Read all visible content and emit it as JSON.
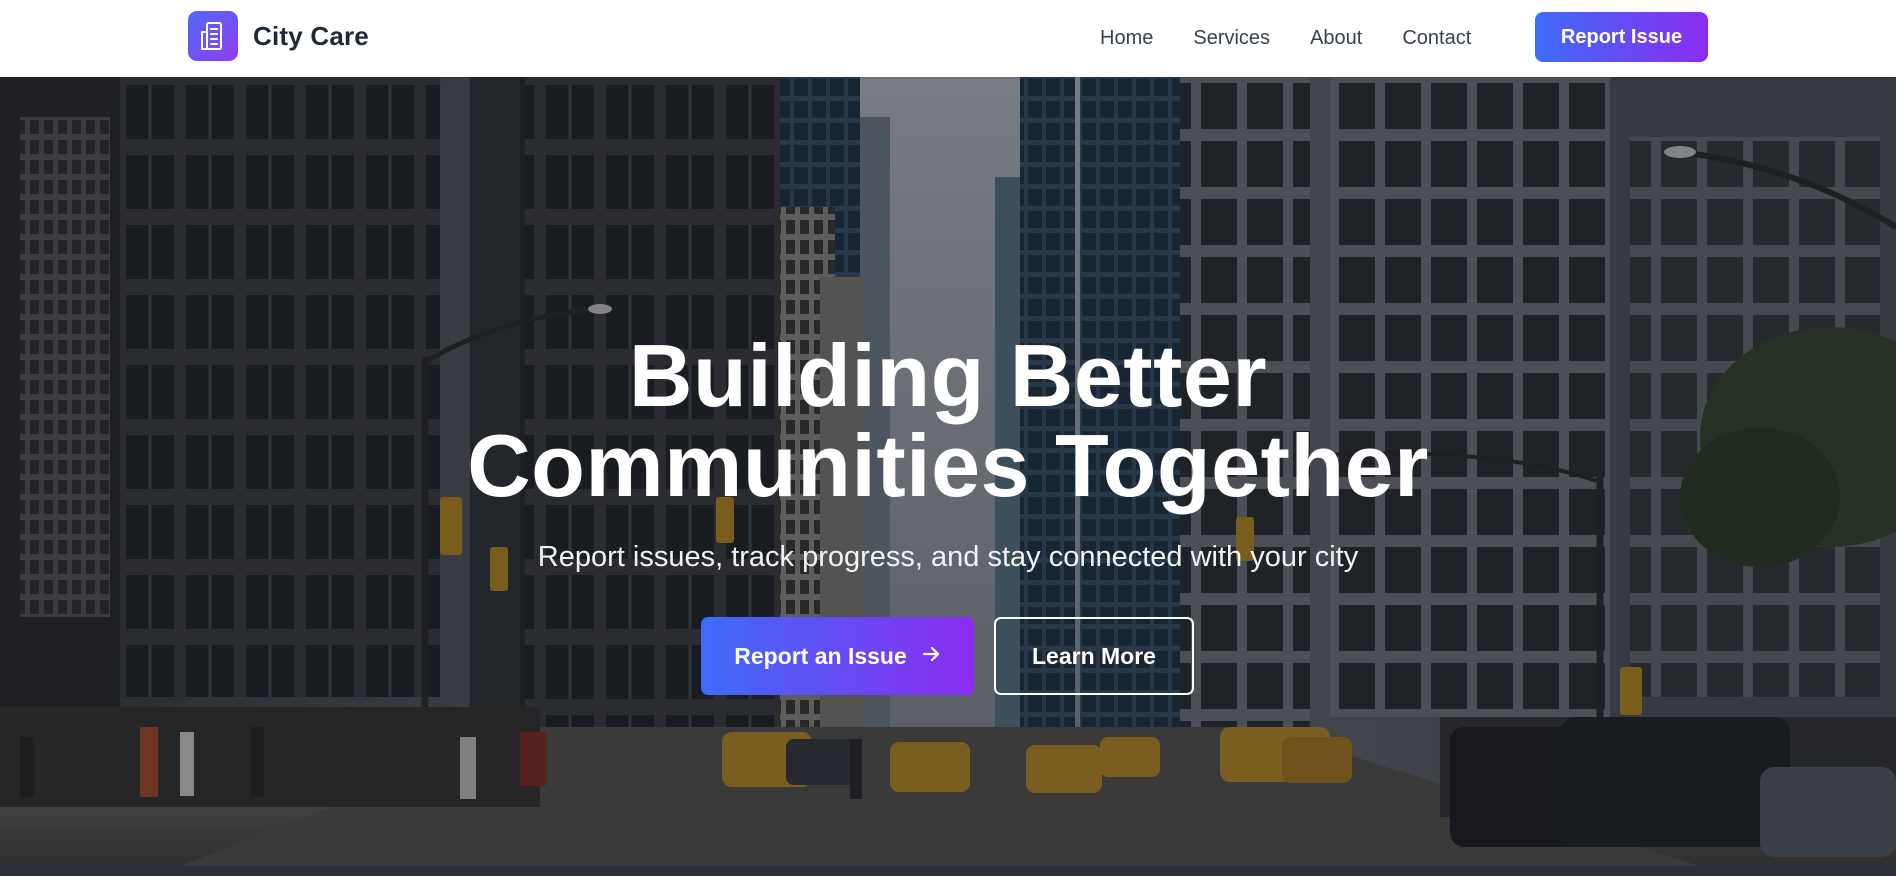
{
  "navbar": {
    "brand_name": "City Care",
    "brand_icon": "building-icon",
    "links": [
      {
        "label": "Home"
      },
      {
        "label": "Services"
      },
      {
        "label": "About"
      },
      {
        "label": "Contact"
      }
    ],
    "cta_label": "Report Issue"
  },
  "hero": {
    "title_line1": "Building Better",
    "title_line2": "Communities Together",
    "subtitle": "Report issues, track progress, and stay connected with your city",
    "primary_button_label": "Report an Issue",
    "primary_button_icon": "arrow-right-icon",
    "secondary_button_label": "Learn More",
    "background_image": "city-street-photo"
  },
  "colors": {
    "accent_start": "#3e6cf8",
    "accent_end": "#8b2cf0",
    "nav_text": "#374151",
    "brand_text": "#1f2937"
  }
}
